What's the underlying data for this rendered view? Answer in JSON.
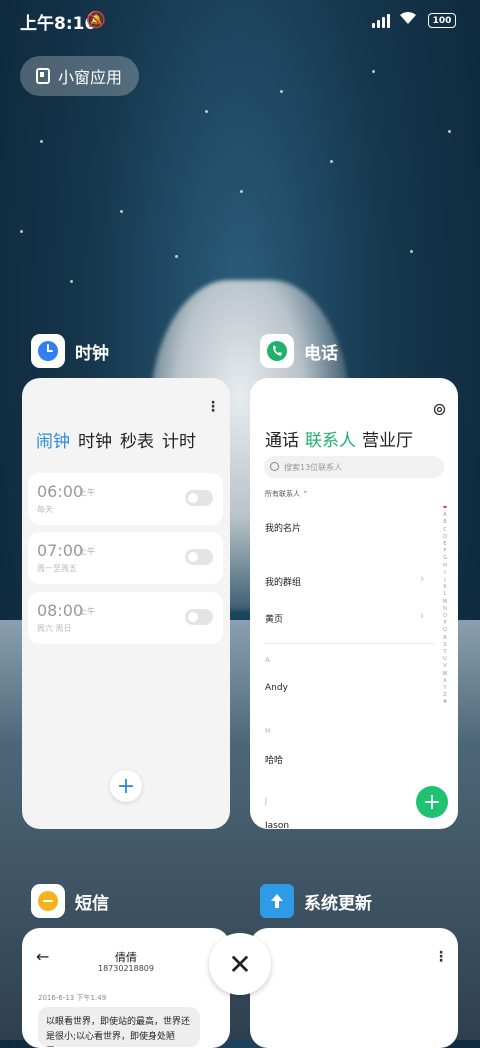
{
  "status_bar": {
    "time": "上午8:16",
    "battery": "100"
  },
  "floating_window_button": {
    "label": "小窗应用"
  },
  "apps": {
    "clock": {
      "name": "时钟",
      "tabs": [
        "闹钟",
        "时钟",
        "秒表",
        "计时"
      ],
      "active_tab": "闹钟",
      "alarms": [
        {
          "time": "06:00",
          "ampm": "上午",
          "repeat": "每天",
          "enabled": false
        },
        {
          "time": "07:00",
          "ampm": "上午",
          "repeat": "周一至周五",
          "enabled": false
        },
        {
          "time": "08:00",
          "ampm": "上午",
          "repeat": "周六 周日",
          "enabled": false
        }
      ],
      "add_label": "+"
    },
    "phone": {
      "name": "电话",
      "tabs": [
        "通话",
        "联系人",
        "营业厅"
      ],
      "active_tab": "联系人",
      "search_placeholder": "搜索13位联系人",
      "filter_label": "所有联系人",
      "rows": {
        "my_card": "我的名片",
        "my_groups": "我的群组",
        "yellow_pages": "黄页",
        "section_a": "A",
        "contact_1": "Andy",
        "section_h": "H",
        "contact_2": "哈哈",
        "section_j": "J",
        "contact_3": "Jason"
      },
      "index_letters": [
        "A",
        "B",
        "C",
        "D",
        "E",
        "F",
        "G",
        "H",
        "I",
        "J",
        "K",
        "L",
        "M",
        "N",
        "O",
        "P",
        "Q",
        "R",
        "S",
        "T",
        "U",
        "V",
        "W",
        "X",
        "Y",
        "Z",
        "#"
      ],
      "fab_label": "+"
    },
    "sms": {
      "name": "短信",
      "contact_name": "倩倩",
      "contact_number": "18730218809",
      "date": "2016-6-13 下午1:49",
      "message": "以眼看世界，即使站的最高，世界还是很小;以心看世界，即使身处陋屋，"
    },
    "update": {
      "name": "系统更新"
    }
  },
  "close_button": {
    "label": "✕"
  },
  "colors": {
    "clock_accent": "#2e8bd8",
    "phone_accent": "#1fb26b",
    "sms_accent": "#f5b21b",
    "update_accent": "#2e9be6"
  }
}
